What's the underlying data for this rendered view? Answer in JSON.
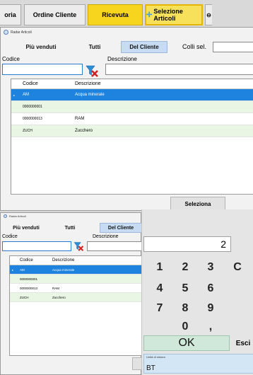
{
  "toolbar": {
    "item0": "oria",
    "item1": "Ordine Cliente",
    "item2": "Ricevuta",
    "item3": "Selezione Articoli"
  },
  "window": {
    "title": "Radar Articoli",
    "tabs": [
      "Più venduti",
      "Tutti",
      "Del Cliente"
    ],
    "colli_label": "Colli sel.",
    "codice_label": "Codice",
    "descrizione_label": "Descrizione",
    "columns": [
      "Codice",
      "Descrizione"
    ],
    "rows": [
      {
        "codice": "AM",
        "descrizione": "Acqua minerale"
      },
      {
        "codice": "0000000001",
        "descrizione": ""
      },
      {
        "codice": "0000000013",
        "descrizione": "RAM"
      },
      {
        "codice": "ZUCH",
        "descrizione": "Zucchero"
      }
    ],
    "select_button": "Seleziona"
  },
  "keypad": {
    "display": "2",
    "keys": [
      "1",
      "2",
      "3",
      "C",
      "4",
      "5",
      "6",
      "7",
      "8",
      "9",
      "0",
      ","
    ],
    "ok": "OK",
    "esci": "Esci",
    "um_label": "Unità di misura",
    "um_value": "BT"
  },
  "colors": {
    "accent_yellow": "#f7d51e",
    "selected_row": "#1d83df",
    "alt_row": "#e9f6e4",
    "ok_button": "#cfe8da"
  }
}
